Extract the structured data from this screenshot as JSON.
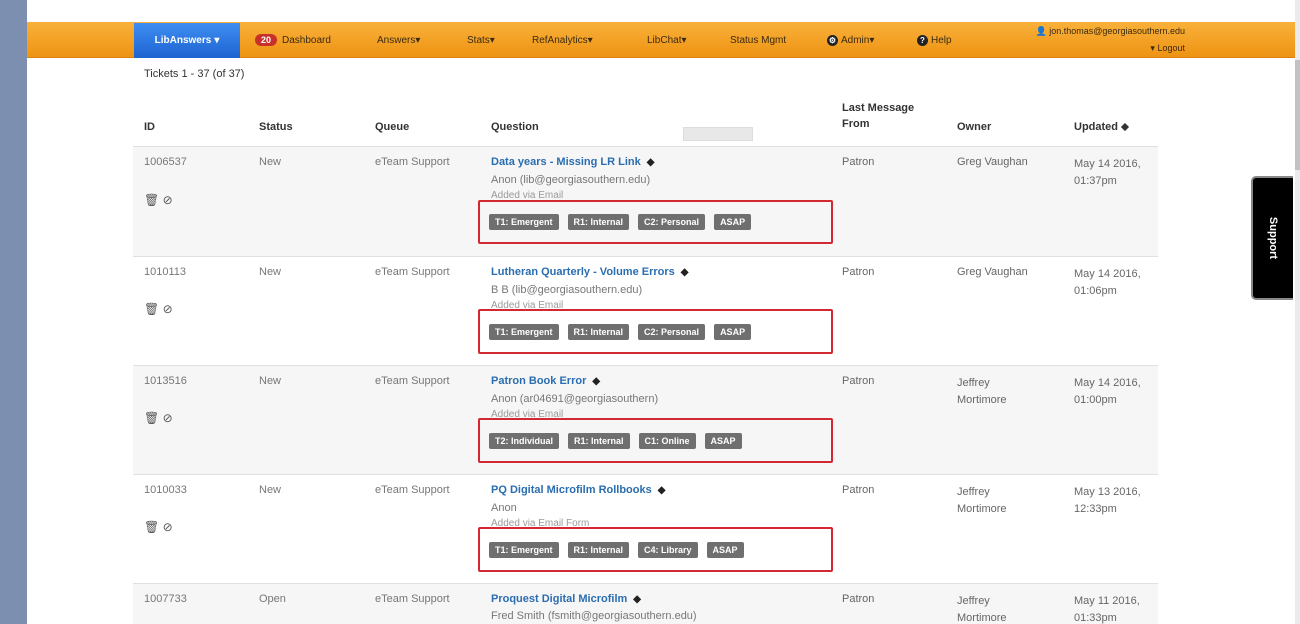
{
  "nav": {
    "brand": "LibAnswers",
    "dashboard_badge": "20",
    "items": [
      "Dashboard",
      "Answers",
      "Stats",
      "RefAnalytics",
      "LibChat",
      "Status Mgmt",
      "Admin",
      "Help"
    ],
    "user_email": "jon.thomas@georgiasouthern.edu",
    "logout": "Logout"
  },
  "tickets_count": "Tickets 1 - 37 (of 37)",
  "table": {
    "headers": {
      "id": "ID",
      "status": "Status",
      "queue": "Queue",
      "question": "Question",
      "last_message_line1": "Last Message",
      "last_message_line2": "From",
      "owner": "Owner",
      "updated": "Updated"
    },
    "rows": [
      {
        "id": "1006537",
        "status": "New",
        "queue": "eTeam Support",
        "question": "Data years - Missing LR Link",
        "from_line": "Anon (lib@georgiasouthern.edu)",
        "extra_line": "Added via Email",
        "tags": [
          "T1: Emergent",
          "R1: Internal",
          "C2: Personal",
          "ASAP"
        ],
        "last_from": "Patron",
        "owner": "Greg Vaughan",
        "updated_1": "May 14 2016,",
        "updated_2": "01:37pm"
      },
      {
        "id": "1010113",
        "status": "New",
        "queue": "eTeam Support",
        "question": "Lutheran Quarterly - Volume Errors",
        "from_line": "B B (lib@georgiasouthern.edu)",
        "extra_line": "Added via Email",
        "tags": [
          "T1: Emergent",
          "R1: Internal",
          "C2: Personal",
          "ASAP"
        ],
        "last_from": "Patron",
        "owner": "Greg Vaughan",
        "updated_1": "May 14 2016,",
        "updated_2": "01:06pm"
      },
      {
        "id": "1013516",
        "status": "New",
        "queue": "eTeam Support",
        "question": "Patron Book Error",
        "from_line": "Anon (ar04691@georgiasouthern)",
        "extra_line": "Added via Email",
        "tags": [
          "T2: Individual",
          "R1: Internal",
          "C1: Online",
          "ASAP"
        ],
        "last_from": "Patron",
        "owner_1": "Jeffrey",
        "owner_2": "Mortimore",
        "updated_1": "May 14 2016,",
        "updated_2": "01:00pm"
      },
      {
        "id": "1010033",
        "status": "New",
        "queue": "eTeam Support",
        "question": "PQ Digital Microfilm Rollbooks",
        "from_line": "Anon",
        "extra_line": "Added via Email Form",
        "tags": [
          "T1: Emergent",
          "R1: Internal",
          "C4: Library",
          "ASAP"
        ],
        "last_from": "Patron",
        "owner_1": "Jeffrey",
        "owner_2": "Mortimore",
        "updated_1": "May 13 2016,",
        "updated_2": "12:33pm"
      },
      {
        "id": "1007733",
        "status": "Open",
        "queue": "eTeam Support",
        "question": "Proquest Digital Microfilm",
        "from_line": "Fred Smith (fsmith@georgiasouthern.edu)",
        "last_from": "Patron",
        "owner_1": "Jeffrey",
        "owner_2": "Mortimore",
        "updated_1": "May 11 2016,",
        "updated_2": "01:33pm"
      }
    ]
  },
  "support_tab": "Support",
  "colors": {
    "nav": "#f2a024",
    "brand": "#2f78e4",
    "tag": "#6f6f6f",
    "highlight_box": "#d3282f",
    "link": "#2a6db0"
  }
}
